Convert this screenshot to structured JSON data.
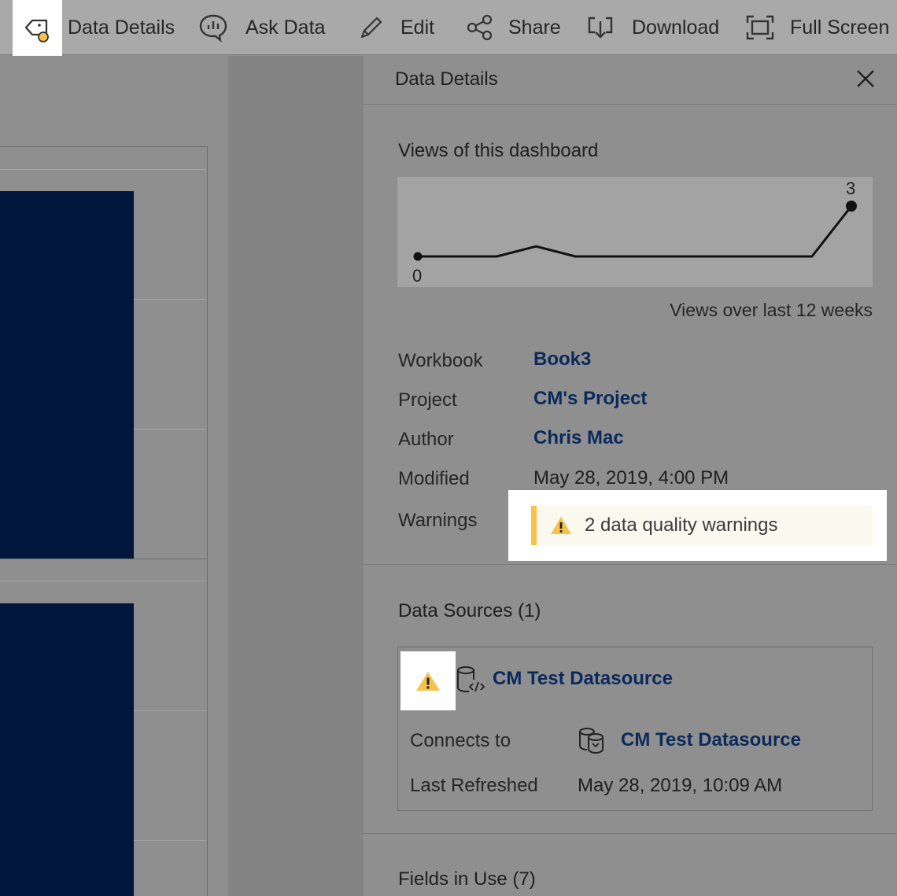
{
  "toolbar": {
    "items": [
      {
        "label": "Data Details",
        "icon": "data-details-icon"
      },
      {
        "label": "Ask Data",
        "icon": "ask-data-icon"
      },
      {
        "label": "Edit",
        "icon": "pencil-icon"
      },
      {
        "label": "Share",
        "icon": "share-icon"
      },
      {
        "label": "Download",
        "icon": "download-icon"
      },
      {
        "label": "Full Screen",
        "icon": "full-screen-icon"
      }
    ]
  },
  "panel": {
    "title": "Data Details",
    "views": {
      "title": "Views of this dashboard",
      "caption": "Views over last 12 weeks",
      "max_label": "3",
      "min_label": "0"
    },
    "meta": {
      "workbook_label": "Workbook",
      "workbook_value": "Book3",
      "project_label": "Project",
      "project_value": "CM's Project",
      "author_label": "Author",
      "author_value": "Chris Mac",
      "modified_label": "Modified",
      "modified_value": "May 28, 2019, 4:00 PM",
      "warnings_label": "Warnings",
      "warnings_value": "2 data quality warnings"
    },
    "data_sources": {
      "title": "Data Sources (1)",
      "name": "CM Test Datasource",
      "connects_label": "Connects to",
      "connects_value": "CM Test Datasource",
      "refreshed_label": "Last Refreshed",
      "refreshed_value": "May 28, 2019, 10:09 AM"
    },
    "fields_title": "Fields in Use (7)"
  },
  "chart_data": {
    "type": "line",
    "title": "Views of this dashboard",
    "xlabel": "Views over last 12 weeks",
    "x": [
      1,
      2,
      3,
      4,
      5,
      6,
      7,
      8,
      9,
      10,
      11,
      12
    ],
    "values": [
      0,
      0,
      0,
      0.6,
      0,
      0,
      0,
      0,
      0,
      0,
      0,
      3
    ],
    "ylim": [
      0,
      3
    ],
    "grid": false
  },
  "colors": {
    "accent_link": "#0a2a5c",
    "warning": "#f5c24b",
    "bar_fill": "#00163d"
  }
}
